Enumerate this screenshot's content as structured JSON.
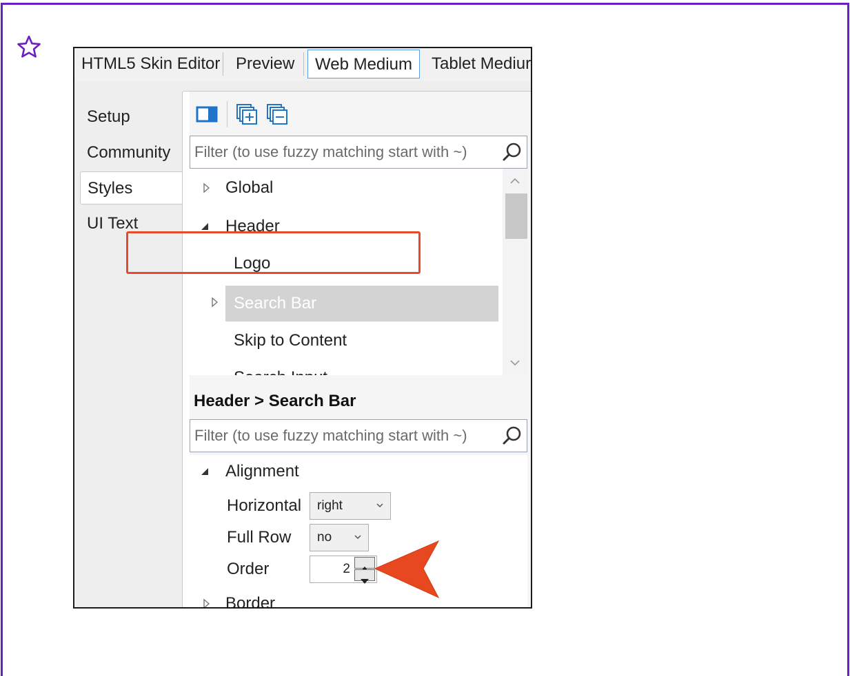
{
  "tabs": [
    {
      "label": "HTML5 Skin Editor"
    },
    {
      "label": "Preview"
    },
    {
      "label": "Web Medium"
    },
    {
      "label": "Tablet Mediur"
    }
  ],
  "sidenav": [
    {
      "label": "Setup"
    },
    {
      "label": "Community"
    },
    {
      "label": "Styles"
    },
    {
      "label": "UI Text"
    }
  ],
  "toolbar": {
    "icons": [
      "toggle-panel-icon",
      "expand-all-icon",
      "collapse-all-icon"
    ]
  },
  "styles_filter": {
    "placeholder": "Filter (to use fuzzy matching start with ~)"
  },
  "tree": [
    {
      "label": "Global",
      "state": "collapsed"
    },
    {
      "label": "Header",
      "state": "expanded"
    },
    {
      "label": "Logo",
      "state": "leaf"
    },
    {
      "label": "Search Bar",
      "state": "collapsed",
      "selected": true
    },
    {
      "label": "Skip to Content",
      "state": "leaf"
    },
    {
      "label": "Search Input",
      "state": "leaf"
    }
  ],
  "section": {
    "title": "Header > Search Bar"
  },
  "props_filter": {
    "placeholder": "Filter (to use fuzzy matching start with ~)"
  },
  "props": {
    "group": "Alignment",
    "horizontal": {
      "label": "Horizontal",
      "value": "right"
    },
    "full_row": {
      "label": "Full Row",
      "value": "no"
    },
    "order": {
      "label": "Order",
      "value": "2"
    },
    "next_group": "Border"
  },
  "colors": {
    "frame": "#6a1fc4",
    "highlight": "#e44a2b",
    "active_tab_border": "#5c9fe0",
    "selection": "#d3d3d3"
  }
}
